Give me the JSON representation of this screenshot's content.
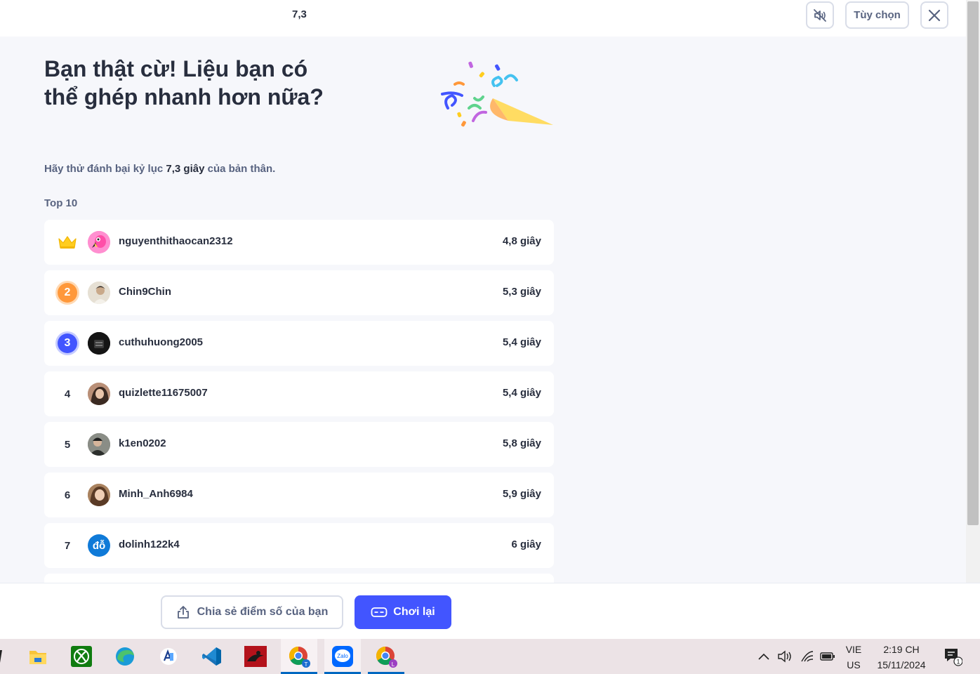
{
  "topbar": {
    "score": "7,3",
    "options_label": "Tùy chọn",
    "mute_icon": "speaker-muted-icon",
    "close_icon": "close-icon"
  },
  "header": {
    "headline": "Bạn thật cừ! Liệu bạn có thể ghép nhanh hơn nữa?",
    "sub_prefix": "Hãy thử đánh bại kỷ lục",
    "sub_record": "7,3 giây",
    "sub_suffix": "của bản thân.",
    "top_label": "Top 10"
  },
  "leaderboard": [
    {
      "rank": "1",
      "rank_style": "crown-icon",
      "username": "nguyenthithaocan2312",
      "time": "4,8 giây",
      "avatar": "flamingo-avatar"
    },
    {
      "rank": "2",
      "rank_style": "orange-medal",
      "username": "Chin9Chin",
      "time": "5,3 giây",
      "avatar": "photo-avatar"
    },
    {
      "rank": "3",
      "rank_style": "blue-medal",
      "username": "cuthuhuong2005",
      "time": "5,4 giây",
      "avatar": "photo-avatar"
    },
    {
      "rank": "4",
      "rank_style": "plain",
      "username": "quizlette11675007",
      "time": "5,4 giây",
      "avatar": "photo-avatar"
    },
    {
      "rank": "5",
      "rank_style": "plain",
      "username": "k1en0202",
      "time": "5,8 giây",
      "avatar": "photo-avatar"
    },
    {
      "rank": "6",
      "rank_style": "plain",
      "username": "Minh_Anh6984",
      "time": "5,9 giây",
      "avatar": "photo-avatar"
    },
    {
      "rank": "7",
      "rank_style": "plain",
      "username": "dolinh122k4",
      "time": "6 giây",
      "avatar": "initials-avatar",
      "avatar_text": "đỗ"
    }
  ],
  "actions": {
    "share_label": "Chia sẻ điểm số của bạn",
    "replay_label": "Chơi lại"
  },
  "taskbar": {
    "apps": [
      "file-explorer-icon",
      "xbox-icon",
      "edge-icon",
      "app-icon",
      "vscode-icon",
      "game-icon",
      "chrome-icon",
      "zalo-icon",
      "chrome-icon"
    ],
    "zalo_text": "Zalo",
    "chrome_badge_1": "T",
    "chrome_badge_2": "L",
    "lang_1": "VIE",
    "lang_2": "US",
    "time": "2:19 CH",
    "date": "15/11/2024",
    "notification_count": "1"
  },
  "colors": {
    "accent": "#4255ff",
    "medal_orange": "#ff983a",
    "medal_blue": "#4255ff",
    "crown": "#ffcd1f"
  }
}
